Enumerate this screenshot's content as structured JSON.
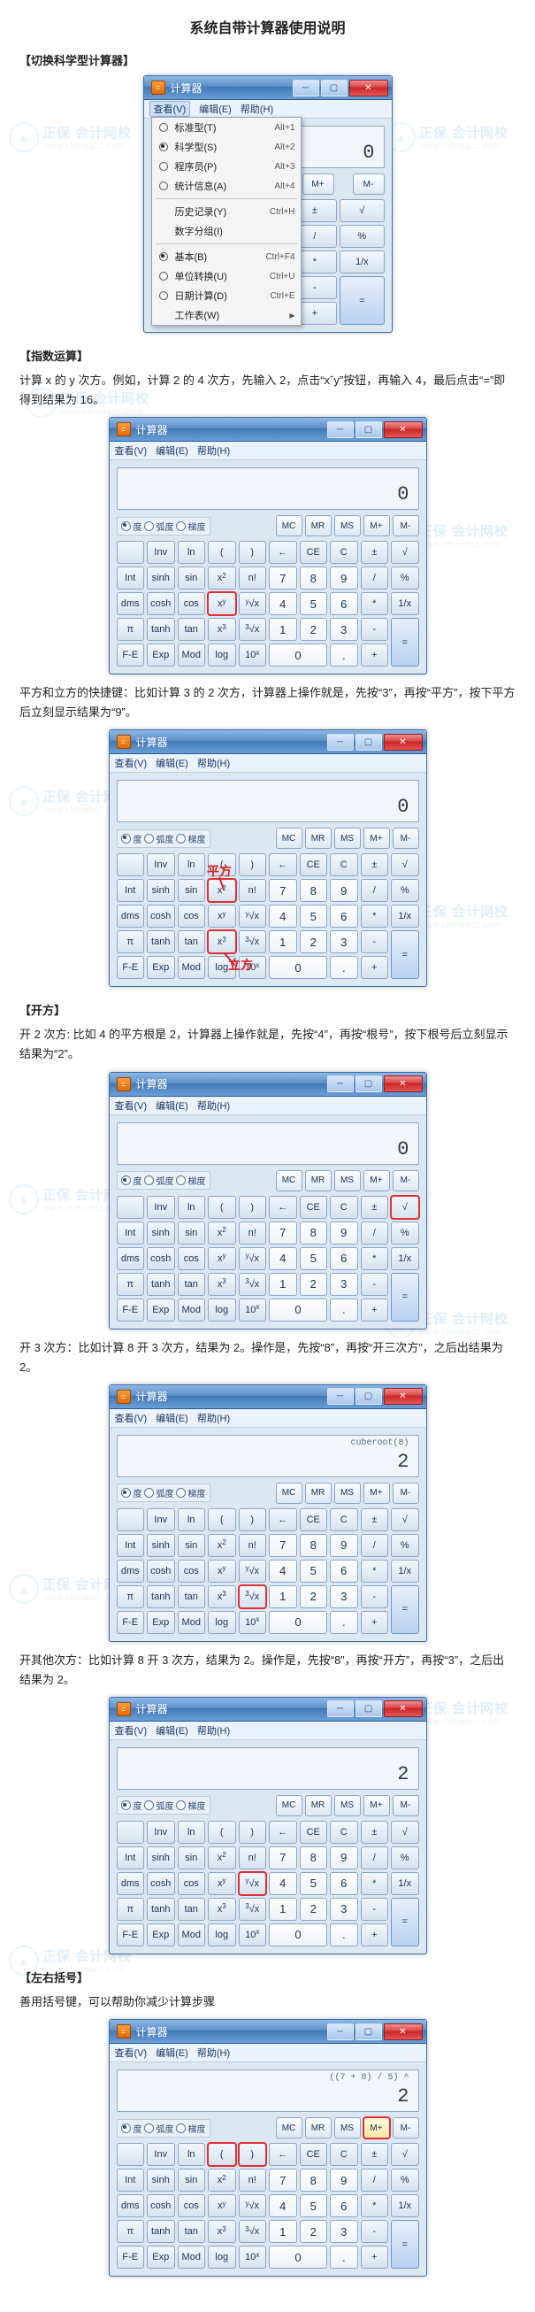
{
  "doc": {
    "title": "系统自带计算器使用说明",
    "watermark_text": "正保 会计网校",
    "watermark_url": "www.chinaacc.com"
  },
  "sections": {
    "switch": {
      "head": "【切换科学型计算器】"
    },
    "exp": {
      "head": "【指数运算】",
      "p1": "计算 x 的 y 次方。例如，计算 2 的 4 次方，先输入 2，点击“xˆy”按钮，再输入 4，最后点击“=”即得到结果为 16。",
      "p2": "平方和立方的快捷键：比如计算 3 的 2 次方，计算器上操作就是，先按“3”，再按“平方”，按下平方后立刻显示结果为“9”。",
      "anno_sq": "平方",
      "anno_cb": "立方"
    },
    "root": {
      "head": "【开方】",
      "p1": "开 2 次方: 比如 4 的平方根是 2，计算器上操作就是，先按“4”，再按“根号”，按下根号后立刻显示结果为“2”。",
      "p2": "开 3 次方：比如计算 8 开 3 次方，结果为 2。操作是，先按“8”，再按“开三次方”，之后出结果为 2。",
      "p3": "开其他次方：比如计算 8 开 3 次方，结果为 2。操作是，先按“8”，再按“开方”，再按“3”，之后出结果为 2。"
    },
    "paren": {
      "head": "【左右括号】",
      "p1": "善用括号键，可以帮助你减少计算步骤"
    }
  },
  "calc_common": {
    "app_title": "计算器",
    "menu": {
      "view": "查看(V)",
      "edit": "编辑(E)",
      "help": "帮助(H)"
    },
    "angle": {
      "deg": "度",
      "rad": "弧度",
      "grad": "梯度"
    },
    "mem": [
      "MC",
      "MR",
      "MS",
      "M+",
      "M-"
    ],
    "row1": [
      "Inv",
      "ln",
      "(",
      ")",
      "←",
      "CE",
      "C",
      "±",
      "√"
    ],
    "row2": [
      "Int",
      "sinh",
      "sin",
      "x²",
      "n!",
      "7",
      "8",
      "9",
      "/",
      "%"
    ],
    "row3": [
      "dms",
      "cosh",
      "cos",
      "xʸ",
      "ʸ√x",
      "4",
      "5",
      "6",
      "*",
      "1/x"
    ],
    "row4": [
      "π",
      "tanh",
      "tan",
      "x³",
      "³√x",
      "1",
      "2",
      "3",
      "-"
    ],
    "row5": [
      "F-E",
      "Exp",
      "Mod",
      "log",
      "10ˣ",
      "0",
      ".",
      "+"
    ],
    "eq": "="
  },
  "calc1": {
    "display": "0",
    "dropdown": [
      {
        "label": "标准型(T)",
        "sc": "Alt+1",
        "radio": true
      },
      {
        "label": "科学型(S)",
        "sc": "Alt+2",
        "radio": true,
        "sel": true
      },
      {
        "label": "程序员(P)",
        "sc": "Alt+3",
        "radio": true
      },
      {
        "label": "统计信息(A)",
        "sc": "Alt+4",
        "radio": true
      },
      {
        "sep": true
      },
      {
        "label": "历史记录(Y)",
        "sc": "Ctrl+H"
      },
      {
        "label": "数字分组(I)"
      },
      {
        "sep": true
      },
      {
        "label": "基本(B)",
        "sc": "Ctrl+F4",
        "radio": true,
        "sel": true
      },
      {
        "label": "单位转换(U)",
        "sc": "Ctrl+U",
        "radio": true
      },
      {
        "label": "日期计算(D)",
        "sc": "Ctrl+E",
        "radio": true
      },
      {
        "label": "工作表(W)",
        "sub": true
      }
    ]
  },
  "calc2": {
    "display": "0"
  },
  "calc3": {
    "display": "0"
  },
  "calc4": {
    "display": "0"
  },
  "calc5": {
    "display": "2",
    "hist": "cuberoot(8)"
  },
  "calc6": {
    "display": "2"
  },
  "calc7": {
    "display": "2",
    "hist": "((7 + 8) / 5) ^"
  }
}
